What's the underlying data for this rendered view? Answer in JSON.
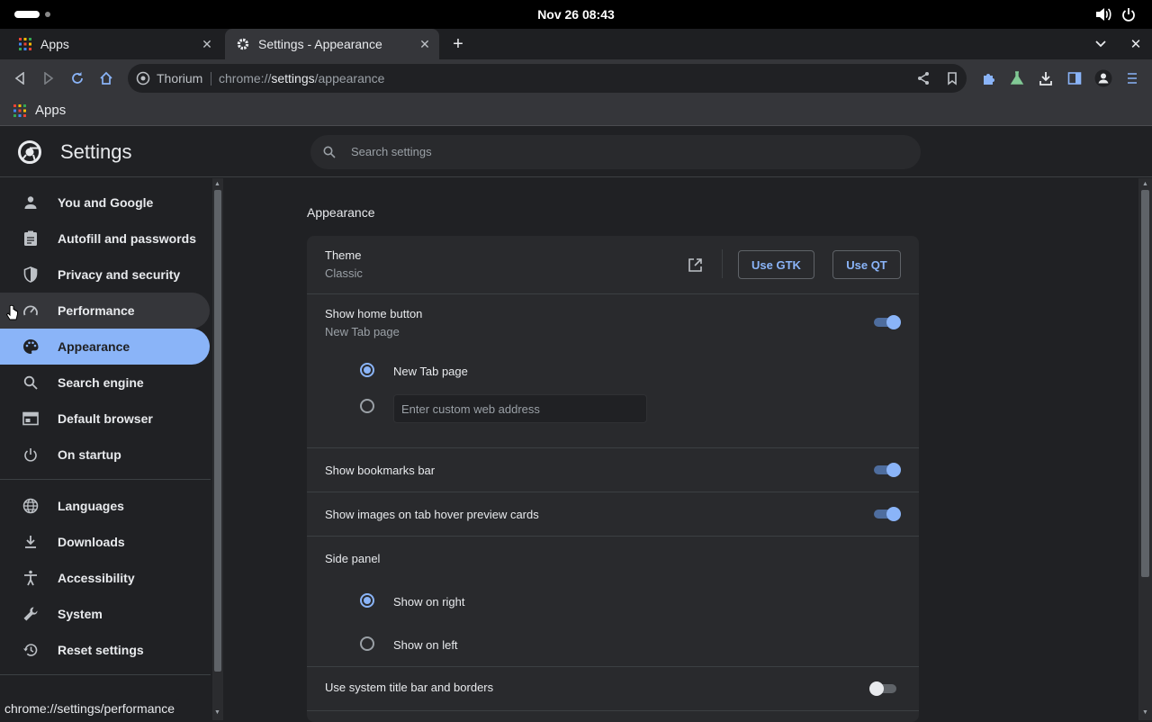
{
  "system_bar": {
    "clock": "Nov 26  08:43"
  },
  "tabs": [
    {
      "label": "Apps"
    },
    {
      "label": "Settings - Appearance"
    }
  ],
  "omnibox": {
    "site": "Thorium",
    "url_prefix": "chrome://",
    "url_host": "settings",
    "url_path": "/appearance"
  },
  "bookmarks_bar": {
    "apps_label": "Apps"
  },
  "settings_header": {
    "title": "Settings",
    "search_placeholder": "Search settings"
  },
  "sidebar": {
    "items": [
      {
        "label": "You and Google",
        "icon": "person-icon"
      },
      {
        "label": "Autofill and passwords",
        "icon": "clipboard-icon"
      },
      {
        "label": "Privacy and security",
        "icon": "shield-icon"
      },
      {
        "label": "Performance",
        "icon": "speedometer-icon"
      },
      {
        "label": "Appearance",
        "icon": "palette-icon"
      },
      {
        "label": "Search engine",
        "icon": "search-icon"
      },
      {
        "label": "Default browser",
        "icon": "browser-icon"
      },
      {
        "label": "On startup",
        "icon": "power-icon"
      },
      {
        "label": "Languages",
        "icon": "globe-icon"
      },
      {
        "label": "Downloads",
        "icon": "download-icon"
      },
      {
        "label": "Accessibility",
        "icon": "accessibility-icon"
      },
      {
        "label": "System",
        "icon": "wrench-icon"
      },
      {
        "label": "Reset settings",
        "icon": "history-icon"
      }
    ],
    "selected": "Appearance",
    "hovered": "Performance"
  },
  "appearance": {
    "section_title": "Appearance",
    "theme": {
      "label": "Theme",
      "value": "Classic",
      "gtk_button": "Use GTK",
      "qt_button": "Use QT"
    },
    "home_button": {
      "label": "Show home button",
      "value": "New Tab page",
      "enabled": true,
      "option_new_tab": "New Tab page",
      "custom_placeholder": "Enter custom web address"
    },
    "bookmarks_bar": {
      "label": "Show bookmarks bar",
      "enabled": true
    },
    "tab_hover_images": {
      "label": "Show images on tab hover preview cards",
      "enabled": true
    },
    "side_panel": {
      "label": "Side panel",
      "option_right": "Show on right",
      "option_left": "Show on left",
      "selected": "Show on right"
    },
    "system_title_bar": {
      "label": "Use system title bar and borders",
      "enabled": false
    }
  },
  "status_bar": {
    "url": "chrome://settings/performance"
  },
  "colors": {
    "accent": "#8ab4f8",
    "background": "#202124",
    "card": "#292a2d",
    "toolbar": "#35363a"
  }
}
